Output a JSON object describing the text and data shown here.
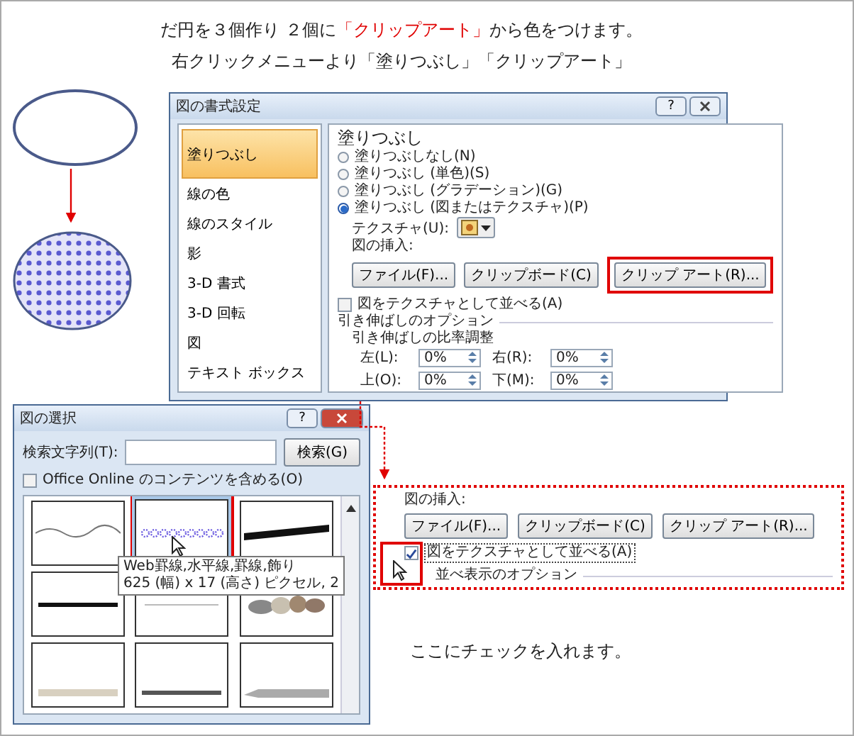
{
  "instructions": {
    "line1": {
      "before": "だ円を３個作り ２個に",
      "highlight": "「クリップアート」",
      "after": "から色をつけます。"
    },
    "line2": "右クリックメニューより「塗りつぶし」「クリップアート」"
  },
  "format_dialog": {
    "title": "図の書式設定",
    "help": "?",
    "sidebar": [
      {
        "label": "塗りつぶし",
        "selected": true
      },
      {
        "label": "線の色",
        "selected": false
      },
      {
        "label": "線のスタイル",
        "selected": false
      },
      {
        "label": "影",
        "selected": false
      },
      {
        "label": "3-D 書式",
        "selected": false
      },
      {
        "label": "3-D 回転",
        "selected": false
      },
      {
        "label": "図",
        "selected": false
      },
      {
        "label": "テキスト ボックス",
        "selected": false
      }
    ],
    "heading": "塗りつぶし",
    "fill_options": [
      {
        "label": "塗りつぶしなし(N)",
        "selected": false
      },
      {
        "label": "塗りつぶし (単色)(S)",
        "selected": false
      },
      {
        "label": "塗りつぶし (グラデーション)(G)",
        "selected": false
      },
      {
        "label": "塗りつぶし (図またはテクスチャ)(P)",
        "selected": true
      }
    ],
    "texture_label": "テクスチャ(U):",
    "insert_label": "図の挿入:",
    "insert_buttons": [
      {
        "label": "ファイル(F)...",
        "highlighted": false
      },
      {
        "label": "クリップボード(C)",
        "highlighted": false
      },
      {
        "label": "クリップ アート(R)...",
        "highlighted": true
      }
    ],
    "tile_checkbox": {
      "label": "図をテクスチャとして並べる(A)",
      "checked": false
    },
    "stretch_section": "引き伸ばしのオプション",
    "offsets_label": "引き伸ばしの比率調整",
    "offsets": [
      {
        "label": "左(L):",
        "value": "0%"
      },
      {
        "label": "右(R):",
        "value": "0%"
      },
      {
        "label": "上(O):",
        "value": "0%"
      },
      {
        "label": "下(M):",
        "value": "0%"
      }
    ]
  },
  "select_dialog": {
    "title": "図の選択",
    "help": "?",
    "search_label": "検索文字列(T):",
    "search_button": "検索(G)",
    "online_checkbox": {
      "label": "Office Online のコンテンツを含める(O)",
      "checked": false
    },
    "thumbnails": [
      {
        "kind": "wave",
        "highlighted": false
      },
      {
        "kind": "dots",
        "highlighted": true
      },
      {
        "kind": "stripes",
        "highlighted": false
      },
      {
        "kind": "thick-line",
        "highlighted": false
      },
      {
        "kind": "thin-line",
        "highlighted": false
      },
      {
        "kind": "stones",
        "highlighted": false
      },
      {
        "kind": "rope",
        "highlighted": false
      },
      {
        "kind": "dark-line",
        "highlighted": false
      },
      {
        "kind": "pencil",
        "highlighted": false
      }
    ],
    "tooltip": [
      "Web罫線,水平線,罫線,飾り",
      "625 (幅) x 17 (高さ) ピクセル, 2"
    ]
  },
  "zoom_panel": {
    "insert_label": "図の挿入:",
    "buttons": [
      "ファイル(F)...",
      "クリップボード(C)",
      "クリップ アート(R)..."
    ],
    "tile_checkbox": {
      "label": "図をテクスチャとして並べる(A)",
      "checked": true
    },
    "section": "並べ表示のオプション"
  },
  "note": "ここにチェックを入れます。"
}
